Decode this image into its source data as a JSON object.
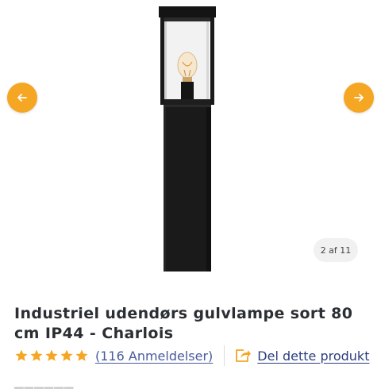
{
  "gallery": {
    "counter": "2 af 11",
    "prev_icon": "arrow-left-icon",
    "next_icon": "arrow-right-icon",
    "accent_color": "#f5a623",
    "product_image": "black-outdoor-post-lamp"
  },
  "product": {
    "title": "Industriel udendørs gulvlampe sort 80 cm IP44 - Charlois",
    "rating": 5,
    "reviews_label": "(116 Anmeldelser)",
    "share_label": "Del dette produkt",
    "share_icon": "share-icon",
    "star_color": "#f5a623"
  }
}
